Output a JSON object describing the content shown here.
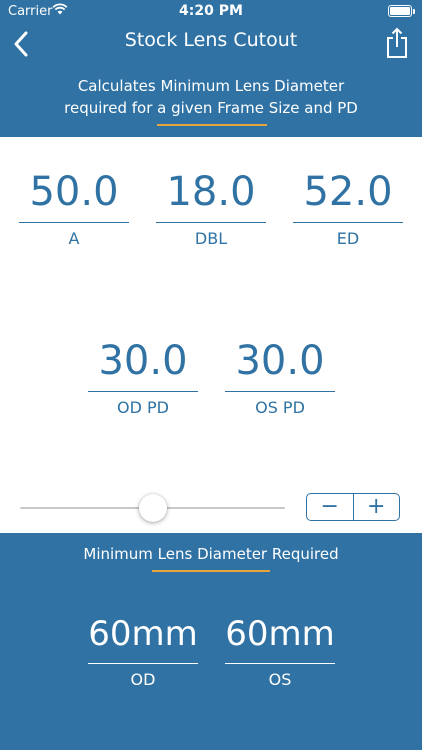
{
  "status_bar": {
    "carrier": "Carrier",
    "time": "4:20 PM"
  },
  "nav": {
    "title": "Stock Lens Cutout"
  },
  "header": {
    "subtitle_line1": "Calculates Minimum Lens Diameter",
    "subtitle_line2": "required for a given Frame Size and PD"
  },
  "inputs": {
    "a": {
      "value": "50.0",
      "label": "A"
    },
    "dbl": {
      "value": "18.0",
      "label": "DBL"
    },
    "ed": {
      "value": "52.0",
      "label": "ED"
    },
    "od_pd": {
      "value": "30.0",
      "label": "OD PD"
    },
    "os_pd": {
      "value": "30.0",
      "label": "OS PD"
    }
  },
  "controls": {
    "minus": "−",
    "plus": "+"
  },
  "result": {
    "title": "Minimum Lens Diameter Required",
    "od": {
      "value": "60mm",
      "label": "OD"
    },
    "os": {
      "value": "60mm",
      "label": "OS"
    }
  },
  "colors": {
    "primary": "#2f72a3",
    "accent": "#e8a33d"
  }
}
